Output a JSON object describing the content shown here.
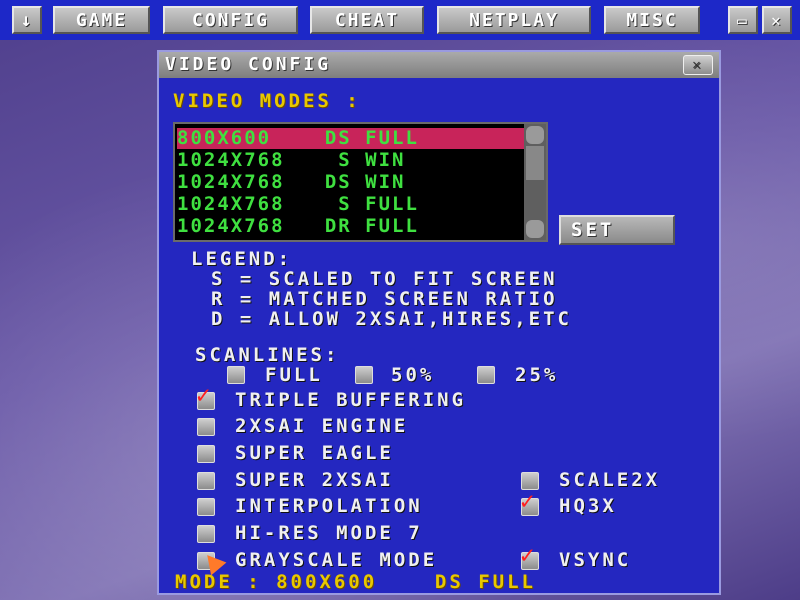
{
  "menubar": {
    "arrow_glyph": "↓",
    "items": [
      "GAME",
      "CONFIG",
      "CHEAT",
      "NETPLAY",
      "MISC"
    ],
    "minimize_glyph": "▭",
    "close_glyph": "✕"
  },
  "window": {
    "title": "VIDEO CONFIG",
    "close_glyph": "✕",
    "video_modes_label": "VIDEO MODES :",
    "modes": [
      "800X600    DS FULL",
      "1024X768    S WIN",
      "1024X768   DS WIN",
      "1024X768    S FULL",
      "1024X768   DR FULL"
    ],
    "selected_mode_index": 0,
    "set_label": "SET",
    "legend": {
      "title": "LEGEND:",
      "lines": [
        "S = SCALED TO FIT SCREEN",
        "R = MATCHED SCREEN RATIO",
        "D = ALLOW 2XSAI,HIRES,ETC"
      ]
    },
    "scanlines": {
      "label": "SCANLINES:",
      "options": [
        "FULL",
        "50%",
        "25%"
      ]
    },
    "options": {
      "triple_buffering": {
        "label": "TRIPLE BUFFERING",
        "checked": true
      },
      "engine_2xsai": {
        "label": "2XSAI ENGINE",
        "checked": false
      },
      "super_eagle": {
        "label": "SUPER EAGLE",
        "checked": false
      },
      "super_2xsai": {
        "label": "SUPER 2XSAI",
        "checked": false
      },
      "interpolation": {
        "label": "INTERPOLATION",
        "checked": false
      },
      "hires_mode7": {
        "label": "HI-RES MODE 7",
        "checked": false
      },
      "grayscale": {
        "label": "GRAYSCALE MODE",
        "checked": false
      },
      "scale2x": {
        "label": "SCALE2X",
        "checked": false
      },
      "hq3x": {
        "label": "HQ3X",
        "checked": true
      },
      "vsync": {
        "label": "VSYNC",
        "checked": true
      }
    },
    "status": "MODE : 800X600    DS FULL",
    "check_glyph": "✓"
  },
  "colors": {
    "menubar_bg": "#1d28c8",
    "window_bg": "#2427c0",
    "selected_row": "#c8245a",
    "list_text": "#3fe040",
    "heading_yellow": "#e8c800",
    "check_red": "#ff2020"
  }
}
